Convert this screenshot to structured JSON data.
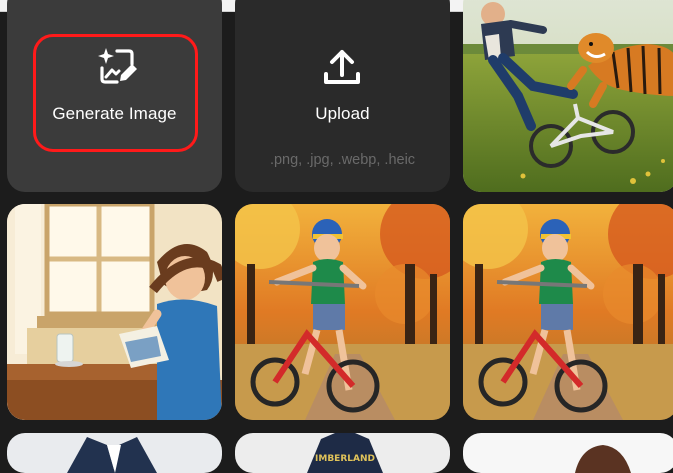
{
  "generate": {
    "label": "Generate Image",
    "icon": "sparkle-image-edit-icon"
  },
  "upload": {
    "label": "Upload",
    "formats": ".png, .jpg, .webp, .heic",
    "icon": "upload-icon"
  },
  "colors": {
    "highlight": "#ff1a1a",
    "tile_dark": "#3b3b3b",
    "tile_darker": "#2a2a2a",
    "background": "#1c1c1c"
  },
  "gallery": {
    "partial_text": "IMBERLAND"
  }
}
